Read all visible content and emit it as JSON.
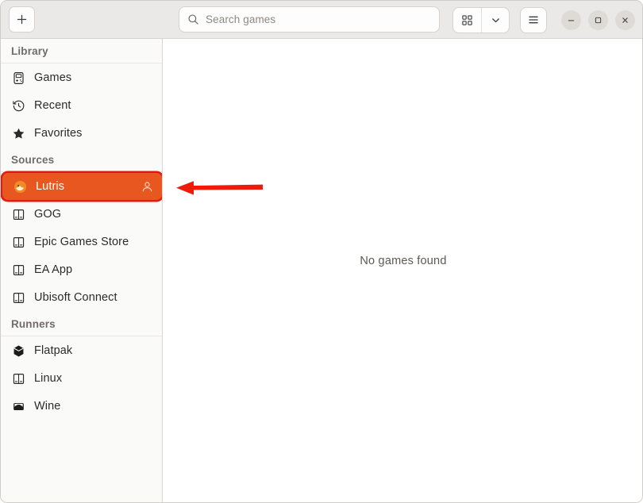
{
  "window": {
    "controls": {
      "minimize_label": "–",
      "maximize_label": "□",
      "close_label": "×"
    }
  },
  "header": {
    "add_button_label": "+",
    "search": {
      "placeholder": "Search games",
      "value": "",
      "icon": "search-icon"
    },
    "view_grid_icon": "grid-view-icon",
    "view_dropdown_icon": "chevron-down-icon",
    "menu_icon": "hamburger-menu-icon"
  },
  "sidebar": {
    "sections": [
      {
        "title": "Library",
        "items": [
          {
            "label": "Games",
            "icon": "gamepad-icon",
            "selected": false
          },
          {
            "label": "Recent",
            "icon": "history-clock-icon",
            "selected": false
          },
          {
            "label": "Favorites",
            "icon": "star-icon",
            "selected": false
          }
        ]
      },
      {
        "title": "Sources",
        "items": [
          {
            "label": "Lutris",
            "icon": "lutris-icon",
            "selected": true,
            "account_icon": "person-icon"
          },
          {
            "label": "GOG",
            "icon": "store-icon",
            "selected": false
          },
          {
            "label": "Epic Games Store",
            "icon": "store-icon",
            "selected": false
          },
          {
            "label": "EA App",
            "icon": "store-icon",
            "selected": false
          },
          {
            "label": "Ubisoft Connect",
            "icon": "store-icon",
            "selected": false
          }
        ]
      },
      {
        "title": "Runners",
        "items": [
          {
            "label": "Flatpak",
            "icon": "box-icon",
            "selected": false
          },
          {
            "label": "Linux",
            "icon": "store-icon",
            "selected": false
          },
          {
            "label": "Wine",
            "icon": "wine-icon",
            "selected": false
          }
        ]
      }
    ]
  },
  "main": {
    "empty_state_text": "No games found"
  },
  "annotation": {
    "arrow_color": "#ee1b0b",
    "arrow_direction": "left",
    "points_to": "Lutris"
  },
  "colors": {
    "accent_selected": "#e8571f",
    "highlight_border": "#e01b10",
    "header_bg": "#ebe9e7",
    "sidebar_bg": "#fafaf9",
    "content_bg": "#ffffff"
  }
}
